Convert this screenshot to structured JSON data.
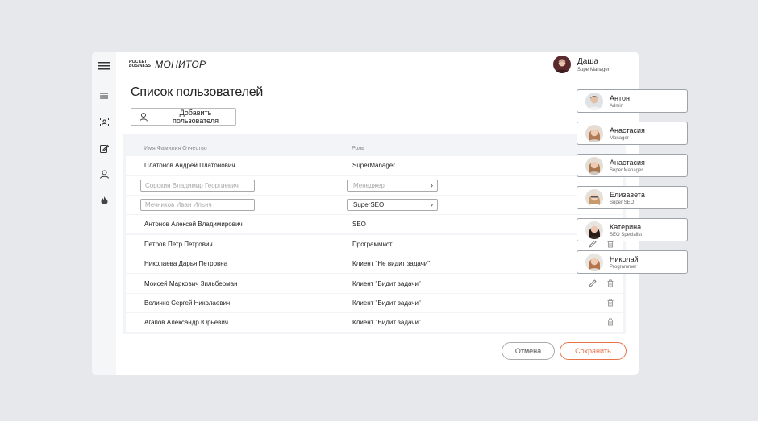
{
  "app": {
    "logo_small_1": "ROCKET",
    "logo_small_2": "BUSINESS",
    "logo_main": "МОНИТОР"
  },
  "user": {
    "name": "Даша",
    "role": "SuperManager"
  },
  "page": {
    "title": "Список пользователей",
    "add_user_label": "Добавить пользователя"
  },
  "table": {
    "headers": {
      "name": "Имя Фамилия Отчество",
      "role": "Роль"
    },
    "rows": [
      {
        "name": "Платонов Андрей Платонович",
        "role": "SuperManager"
      },
      {
        "name": "Сорокин Владимир Георгиевич",
        "role": "Менеджер"
      },
      {
        "name": "Мечников Иван Ильич",
        "role": "SuperSEO"
      },
      {
        "name": "Антонов Алексей Владимирович",
        "role": "SEO"
      },
      {
        "name": "Петров Петр Петрович",
        "role": "Программист"
      },
      {
        "name": "Николаева Дарья Петровна",
        "role": "Клиент \"Не видит задачи\""
      },
      {
        "name": "Моисей Маркович Зильберман",
        "role": "Клиент \"Видит задачи\""
      },
      {
        "name": "Величко Сергей Николаевич",
        "role": "Клиент \"Видит задачи\""
      },
      {
        "name": "Агапов Александр Юрьевич",
        "role": "Клиент \"Видит задачи\""
      }
    ]
  },
  "buttons": {
    "cancel": "Отмена",
    "save": "Сохранить"
  },
  "dropdown": {
    "items": [
      {
        "name": "Антон",
        "role": "Admin"
      },
      {
        "name": "Анастасия",
        "role": "Manager"
      },
      {
        "name": "Анастасия",
        "role": "Super Manager"
      },
      {
        "name": "Елизавета",
        "role": "Super SEO"
      },
      {
        "name": "Катерина",
        "role": "SEO Specialist"
      },
      {
        "name": "Николай",
        "role": "Programmer"
      }
    ]
  },
  "colors": {
    "accent": "#e8734a",
    "background": "#e6e8eb",
    "sidebar": "#f5f6f8",
    "table_bg": "#f3f4f7"
  }
}
